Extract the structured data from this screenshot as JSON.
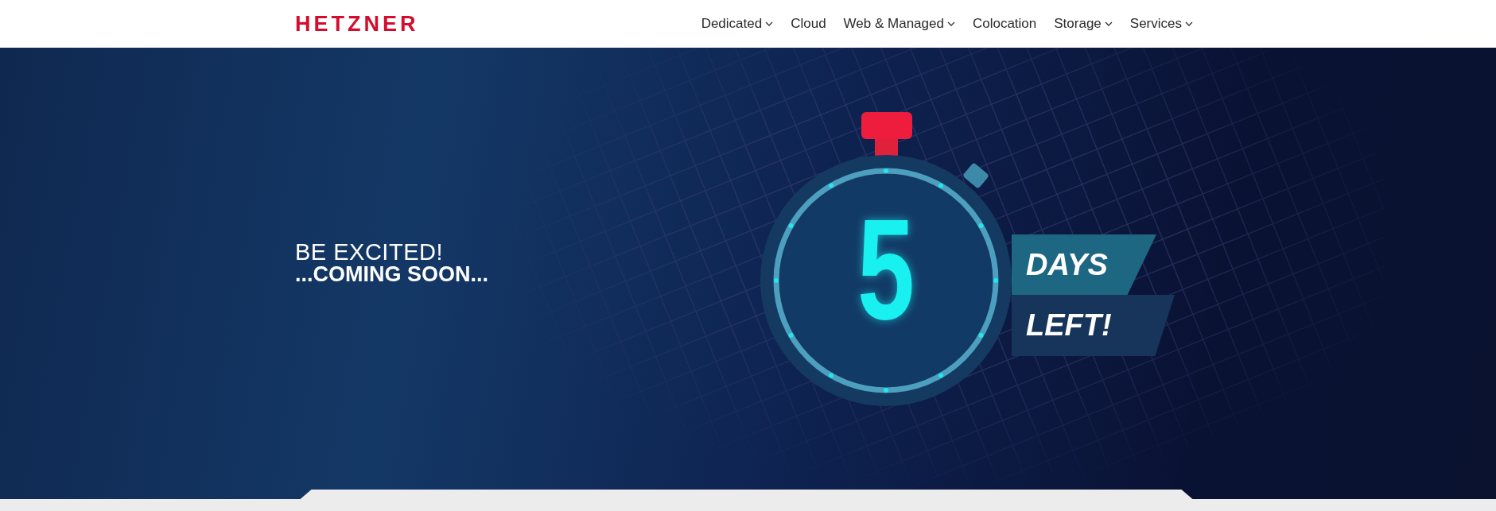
{
  "header": {
    "logo": "HETZNER",
    "nav": [
      {
        "label": "Dedicated",
        "dropdown": true
      },
      {
        "label": "Cloud",
        "dropdown": false
      },
      {
        "label": "Web & Managed",
        "dropdown": true
      },
      {
        "label": "Colocation",
        "dropdown": false
      },
      {
        "label": "Storage",
        "dropdown": true
      },
      {
        "label": "Services",
        "dropdown": true
      }
    ]
  },
  "hero": {
    "kicker": "BE EXCITED!",
    "headline": "...COMING SOON...",
    "countdown": {
      "number": "5",
      "line_1": "DAYS",
      "line_2": "LEFT!"
    }
  }
}
